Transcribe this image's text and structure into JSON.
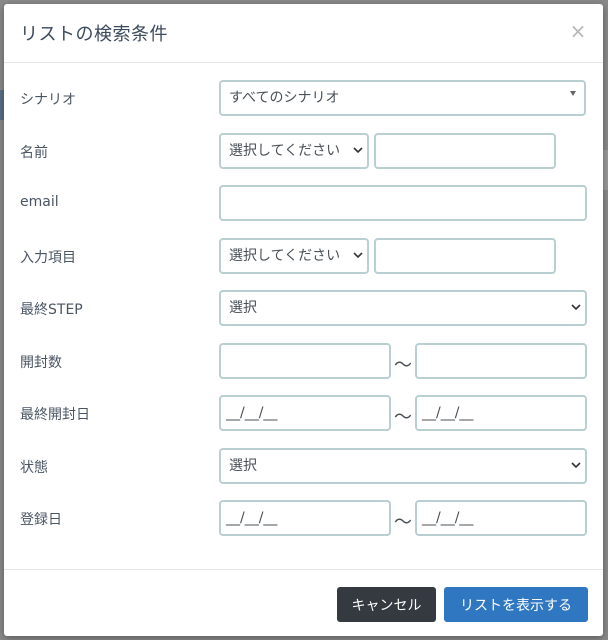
{
  "modal": {
    "title": "リストの検索条件",
    "close_glyph": "×"
  },
  "fields": {
    "scenario": {
      "label": "シナリオ",
      "value": "すべてのシナリオ"
    },
    "name": {
      "label": "名前",
      "select_value": "選択してください",
      "text_value": ""
    },
    "email": {
      "label": "email",
      "value": ""
    },
    "input_item": {
      "label": "入力項目",
      "select_value": "選択してください",
      "text_value": ""
    },
    "last_step": {
      "label": "最終STEP",
      "value": "選択"
    },
    "open_count": {
      "label": "開封数",
      "from": "",
      "to": "",
      "separator": "〜"
    },
    "last_open_date": {
      "label": "最終開封日",
      "from": "__/__/__",
      "to": "__/__/__",
      "separator": "〜"
    },
    "status": {
      "label": "状態",
      "value": "選択"
    },
    "registered_date": {
      "label": "登録日",
      "from": "__/__/__",
      "to": "__/__/__",
      "separator": "〜"
    }
  },
  "footer": {
    "cancel_label": "キャンセル",
    "show_list_label": "リストを表示する"
  },
  "colors": {
    "cancel_button": "#343a40",
    "primary_button": "#3077c2",
    "input_border": "#b9cfd2",
    "title_text": "#3b4a5c"
  }
}
